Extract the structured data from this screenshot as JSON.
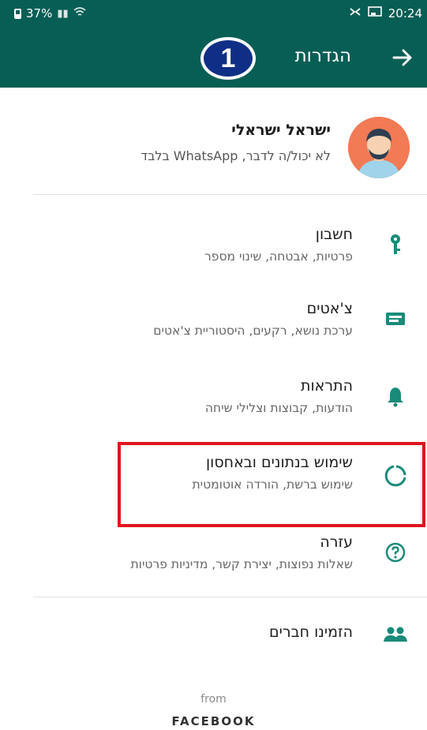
{
  "status_bar": {
    "battery": "37%",
    "time": "20:24",
    "icons": [
      "battery-icon",
      "signal-icon",
      "wifi-icon",
      "bluetooth-icon",
      "cast-icon"
    ]
  },
  "app_bar": {
    "title": "הגדרות",
    "back_icon": "arrow-right-icon",
    "step_badge": "1",
    "color": "#075e54"
  },
  "profile": {
    "name": "ישראל ישראלי",
    "status": "לא יכול/ה לדבר, WhatsApp בלבד",
    "avatar_color": "#f27a55"
  },
  "settings": [
    {
      "id": "account",
      "title": "חשבון",
      "subtitle": "פרטיות, אבטחה, שינוי מספר",
      "icon": "key-icon"
    },
    {
      "id": "chats",
      "title": "צ'אטים",
      "subtitle": "ערכת נושא, רקעים, היסטוריית צ'אטים",
      "icon": "chat-icon"
    },
    {
      "id": "notifications",
      "title": "התראות",
      "subtitle": "הודעות, קבוצות וצלילי שיחה",
      "icon": "bell-icon"
    },
    {
      "id": "storage",
      "title": "שימוש בנתונים ובאחסון",
      "subtitle": "שימוש ברשת, הורדה אוטומטית",
      "icon": "data-usage-icon",
      "highlighted": true
    },
    {
      "id": "help",
      "title": "עזרה",
      "subtitle": "שאלות נפוצות, יצירת קשר, מדיניות פרטיות",
      "icon": "help-icon"
    },
    {
      "id": "invite",
      "title": "הזמינו חברים",
      "subtitle": "",
      "icon": "people-icon"
    }
  ],
  "icon_color": "#1a8a7a",
  "highlight_color": "#e0141c",
  "footer": {
    "from": "from",
    "brand": "FACEBOOK"
  }
}
